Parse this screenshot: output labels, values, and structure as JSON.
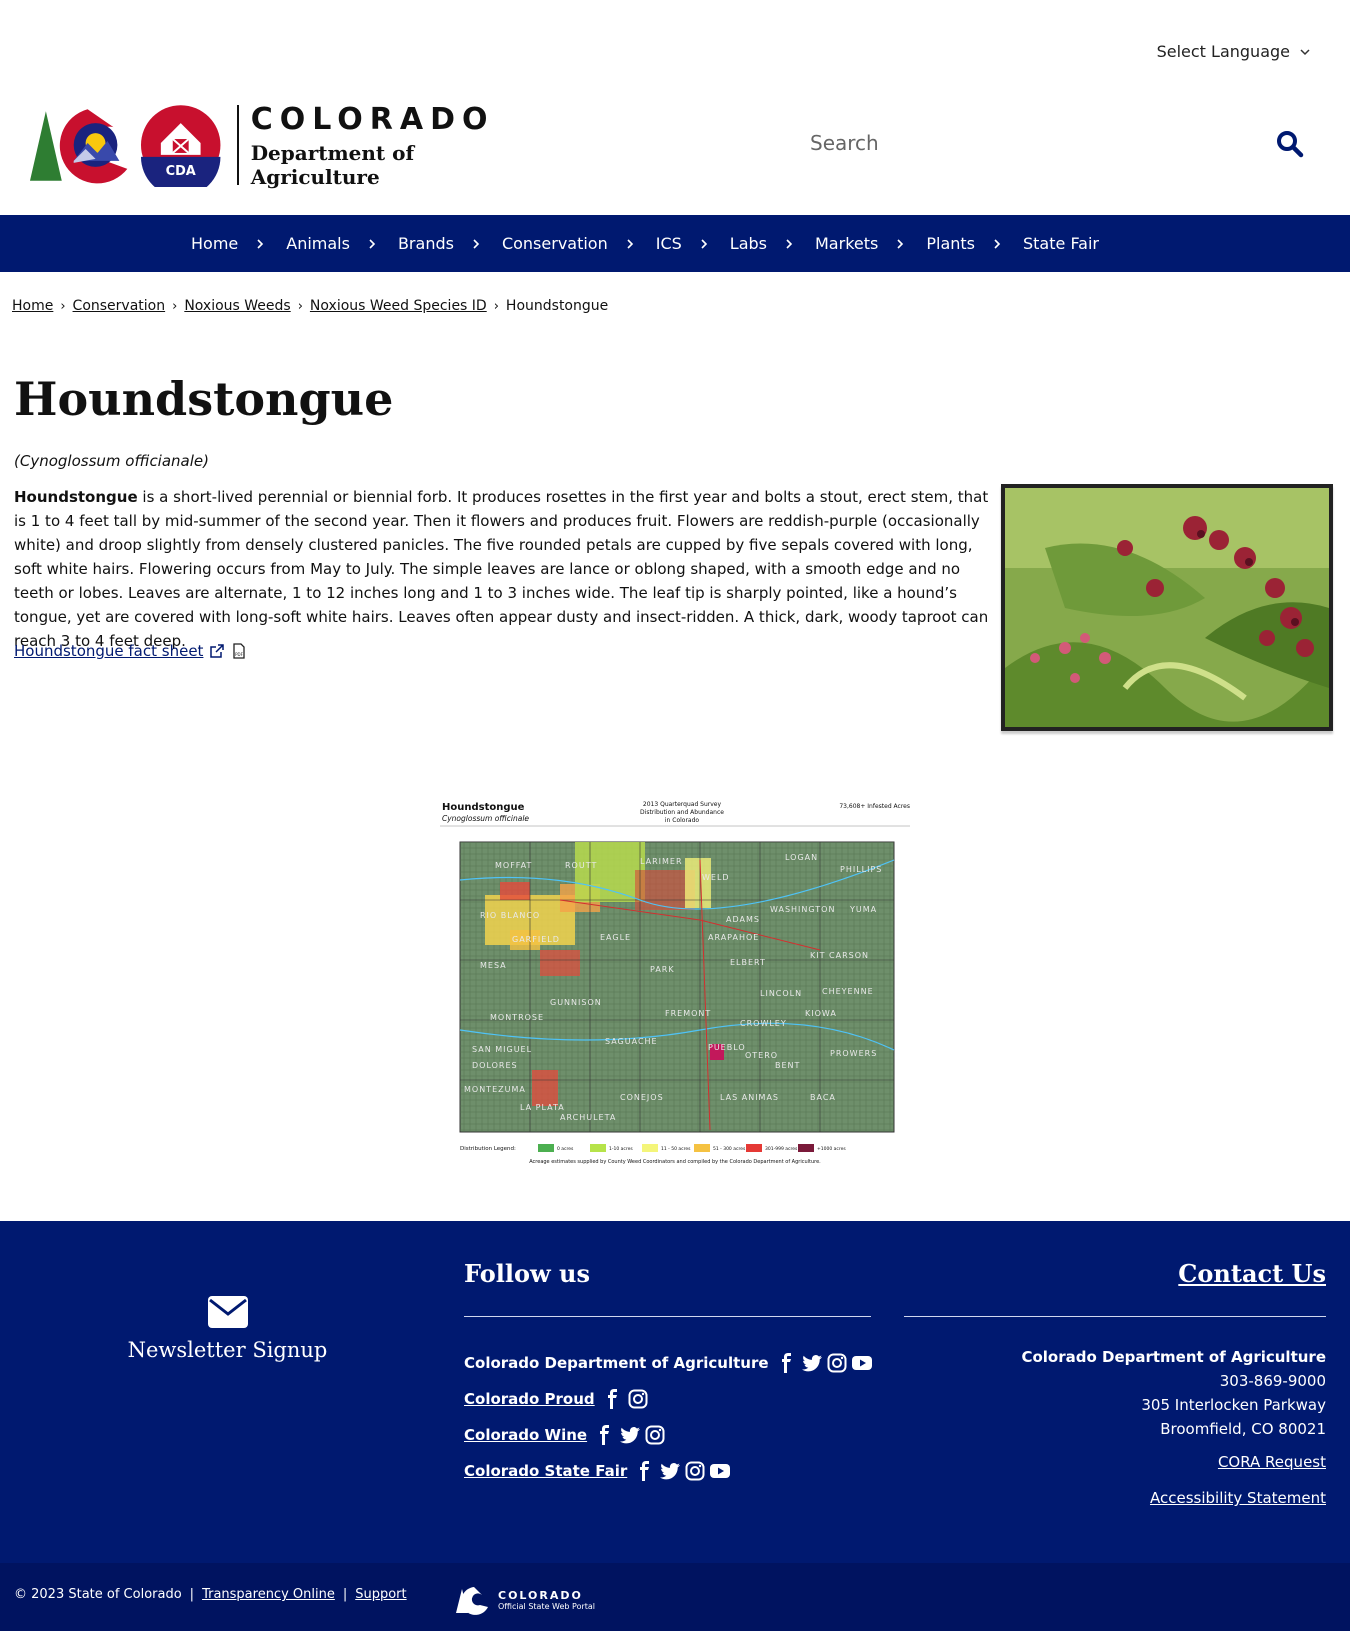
{
  "language": {
    "label": "Select Language"
  },
  "header": {
    "logo_word": "COLORADO",
    "logo_dept": "Department of Agriculture",
    "logo_badge": "CDA",
    "search_placeholder": "Search"
  },
  "nav": [
    {
      "label": "Home"
    },
    {
      "label": "Animals"
    },
    {
      "label": "Brands"
    },
    {
      "label": "Conservation"
    },
    {
      "label": "ICS"
    },
    {
      "label": "Labs"
    },
    {
      "label": "Markets"
    },
    {
      "label": "Plants"
    },
    {
      "label": "State Fair"
    }
  ],
  "breadcrumb": {
    "items": [
      "Home",
      "Conservation",
      "Noxious Weeds",
      "Noxious Weed Species ID"
    ],
    "current": "Houndstongue"
  },
  "page": {
    "title": "Houndstongue",
    "scientific_name": "(Cynoglossum officianale)",
    "desc_bold": "Houndstongue",
    "desc_rest": " is a short-lived perennial or biennial forb. It produces rosettes in the first year and bolts a stout, erect stem, that is 1 to 4 feet tall by mid-summer of the second year. Then it flowers and produces fruit. Flowers are reddish-purple (occasionally white) and droop slightly from densely clustered panicles. The five rounded petals are cupped by five sepals covered with long, soft white hairs. Flowering occurs from May to July. The simple leaves are lance or oblong shaped, with a smooth edge and no teeth or lobes. Leaves are alternate, 1 to 12 inches long and 1 to 3 inches wide. The leaf tip is sharply pointed, like a hound’s tongue, yet are covered with long-soft white hairs. Leaves often appear dusty and insect-ridden. A thick, dark, woody taproot can reach 3 to 4 feet deep.",
    "fact_sheet_link": "Houndstongue fact sheet"
  },
  "map": {
    "title": "Houndstongue",
    "subtitle": "Cynoglossum officinale",
    "survey_line1": "2013 Quarterquad Survey",
    "survey_line2": "Distribution and Abundance",
    "survey_line3": "in Colorado",
    "infested": "73,608+ Infested Acres",
    "legend_title": "Distribution Legend:",
    "legend": [
      {
        "label": "0 acres",
        "color": "#4caf50"
      },
      {
        "label": "1-10 acres",
        "color": "#b6e34a"
      },
      {
        "label": "11 - 50 acres",
        "color": "#f4f57a"
      },
      {
        "label": "51 - 300 acres",
        "color": "#f5c242"
      },
      {
        "label": "301-999 acres",
        "color": "#e53935"
      },
      {
        "label": "+1000 acres",
        "color": "#7a1a3a"
      }
    ],
    "note": "Acreage estimates supplied by County Weed Coordinators and compiled by the Colorado Department of Agriculture.",
    "counties": [
      "MOFFAT",
      "LARIMER",
      "WELD",
      "LOGAN",
      "PHILLIPS",
      "RIO BLANCO",
      "GARFIELD",
      "ADAMS",
      "WASHINGTON",
      "YUMA",
      "ARAPAHOE",
      "ELBERT",
      "KIT CARSON",
      "LINCOLN",
      "CHEYENNE",
      "MESA",
      "PARK",
      "MONTROSE",
      "SAGUACHE",
      "FREMONT",
      "PUEBLO",
      "CROWLEY",
      "KIOWA",
      "OTERO",
      "BENT",
      "PROWERS",
      "SAN MIGUEL",
      "DOLORES",
      "MONTEZUMA",
      "LA PLATA",
      "ARCHULETA",
      "CONEJOS",
      "LAS ANIMAS",
      "BACA",
      "GUNNISON",
      "EAGLE",
      "ROUTT"
    ]
  },
  "footer": {
    "newsletter": "Newsletter Signup",
    "follow_title": "Follow us",
    "follow": [
      {
        "label": "Colorado Department of Agriculture",
        "link": false,
        "icons": [
          "facebook-icon",
          "twitter-icon",
          "instagram-icon",
          "youtube-icon"
        ]
      },
      {
        "label": "Colorado Proud",
        "link": true,
        "icons": [
          "facebook-icon",
          "instagram-icon"
        ]
      },
      {
        "label": "Colorado Wine",
        "link": true,
        "icons": [
          "facebook-icon",
          "twitter-icon",
          "instagram-icon"
        ]
      },
      {
        "label": "Colorado State Fair",
        "link": true,
        "icons": [
          "facebook-icon",
          "twitter-icon",
          "instagram-icon",
          "youtube-icon"
        ]
      }
    ],
    "contact_title": "Contact Us",
    "contact_org": "Colorado Department of Agriculture",
    "contact_phone": "303-869-9000",
    "contact_street": "305 Interlocken Parkway",
    "contact_city": "Broomfield, CO 80021",
    "cora": "CORA Request",
    "accessibility": "Accessibility Statement"
  },
  "bottom": {
    "copyright": "© 2023 State of Colorado",
    "sep": "|",
    "transparency": "Transparency Online",
    "support": "Support",
    "portal_word": "COLORADO",
    "portal_sub": "Official State Web Portal"
  },
  "colors": {
    "nav_bg": "#001970",
    "footer_bg": "#001970",
    "bottom_bg": "#001360"
  }
}
